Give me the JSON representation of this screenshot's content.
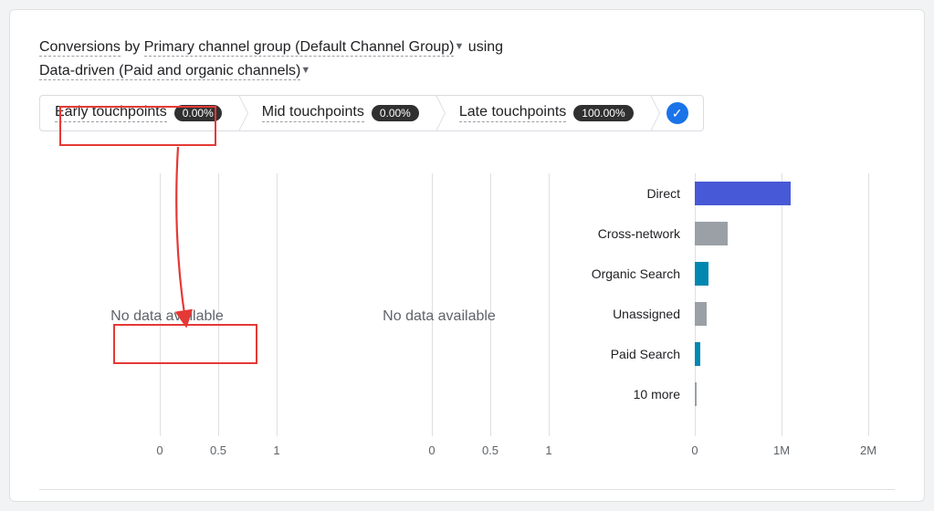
{
  "header": {
    "conversions": "Conversions",
    "by": " by ",
    "primary": "Primary channel group (Default Channel Group)",
    "using": " using",
    "model": "Data-driven (Paid and organic channels)"
  },
  "stages": [
    {
      "label": "Early touchpoints",
      "badge": "0.00%"
    },
    {
      "label": "Mid touchpoints",
      "badge": "0.00%"
    },
    {
      "label": "Late touchpoints",
      "badge": "100.00%"
    }
  ],
  "charts": {
    "early": {
      "nodata": "No data available",
      "ticks": [
        "0",
        "0.5",
        "1"
      ]
    },
    "mid": {
      "nodata": "No data available",
      "ticks": [
        "0",
        "0.5",
        "1"
      ]
    },
    "late": {
      "ticks": [
        "0",
        "1M",
        "2M"
      ],
      "bars": [
        {
          "label": "Direct",
          "value": 1100000,
          "color": "#4759d6"
        },
        {
          "label": "Cross-network",
          "value": 380000,
          "color": "#9aa0a6"
        },
        {
          "label": "Organic Search",
          "value": 160000,
          "color": "#0288b0"
        },
        {
          "label": "Unassigned",
          "value": 140000,
          "color": "#9aa0a6"
        },
        {
          "label": "Paid Search",
          "value": 60000,
          "color": "#0288b0"
        },
        {
          "label": "10 more",
          "value": 20000,
          "color": "#9aa0a6"
        }
      ],
      "xmax": 2000000
    }
  },
  "chart_data": [
    {
      "type": "bar",
      "title": "Early touchpoints",
      "categories": [],
      "values": [],
      "note": "No data available",
      "xlim": [
        0,
        1
      ]
    },
    {
      "type": "bar",
      "title": "Mid touchpoints",
      "categories": [],
      "values": [],
      "note": "No data available",
      "xlim": [
        0,
        1
      ]
    },
    {
      "type": "bar",
      "title": "Late touchpoints",
      "xlim": [
        0,
        2000000
      ],
      "categories": [
        "Direct",
        "Cross-network",
        "Organic Search",
        "Unassigned",
        "Paid Search",
        "10 more"
      ],
      "values": [
        1100000,
        380000,
        160000,
        140000,
        60000,
        20000
      ]
    }
  ]
}
